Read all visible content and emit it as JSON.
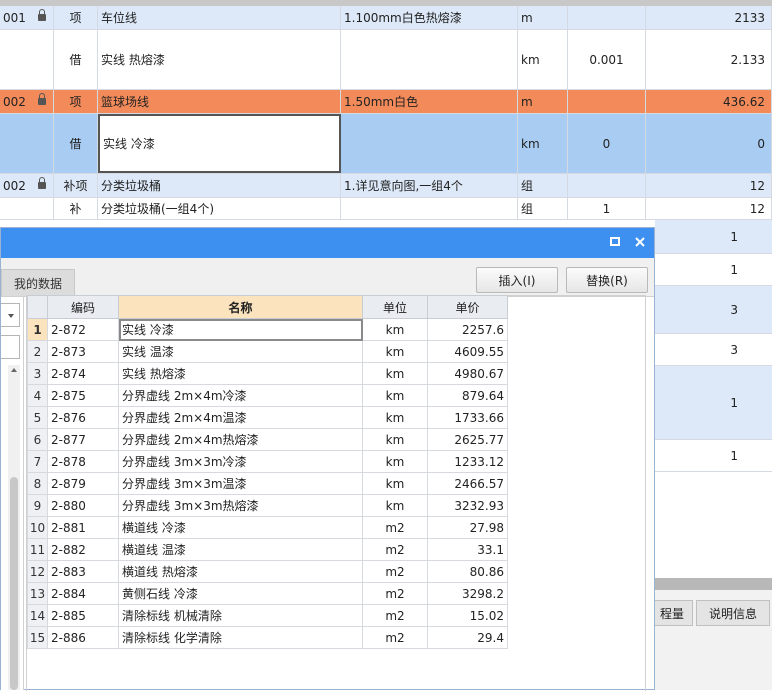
{
  "background_rows": [
    {
      "code": "001",
      "type": "项",
      "name": "车位线",
      "spec": "1.100mm白色热熔漆",
      "unit": "m",
      "qty": "",
      "total": "2133",
      "bg": "#dde9f8",
      "locked": true
    },
    {
      "code": "",
      "type": "借",
      "name": "实线 热熔漆",
      "spec": "",
      "unit": "km",
      "qty": "0.001",
      "total": "2.133",
      "bg": "#ffffff",
      "locked": false
    },
    {
      "code": "002",
      "type": "项",
      "name": "篮球场线",
      "spec": "1.50mm白色",
      "unit": "m",
      "qty": "",
      "total": "436.62",
      "bg": "#f28a5a",
      "locked": true
    },
    {
      "code": "",
      "type": "借",
      "name": "实线 冷漆",
      "spec": "",
      "unit": "km",
      "qty": "0",
      "total": "0",
      "bg": "#a9cdf2",
      "locked": false
    },
    {
      "code": "002",
      "type": "补项",
      "name": "分类垃圾桶",
      "spec": "1.详见意向图,一组4个",
      "unit": "组",
      "qty": "",
      "total": "12",
      "bg": "#dde9f8",
      "locked": true
    },
    {
      "code": "",
      "type": "补",
      "name": "分类垃圾桶(一组4个)",
      "spec": "",
      "unit": "组",
      "qty": "1",
      "total": "12",
      "bg": "#ffffff",
      "locked": false
    }
  ],
  "right_column_values": [
    "1",
    "1",
    "3",
    "3",
    "1",
    "1"
  ],
  "dialog": {
    "tab_label": "我的数据",
    "insert_button": "插入(I)",
    "replace_button": "替换(R)",
    "columns": {
      "code": "编码",
      "name": "名称",
      "unit": "单位",
      "price": "单价"
    },
    "rows": [
      {
        "idx": "1",
        "code": "2-872",
        "name": "实线 冷漆",
        "unit": "km",
        "price": "2257.6"
      },
      {
        "idx": "2",
        "code": "2-873",
        "name": "实线 温漆",
        "unit": "km",
        "price": "4609.55"
      },
      {
        "idx": "3",
        "code": "2-874",
        "name": "实线 热熔漆",
        "unit": "km",
        "price": "4980.67"
      },
      {
        "idx": "4",
        "code": "2-875",
        "name": "分界虚线 2m×4m冷漆",
        "unit": "km",
        "price": "879.64"
      },
      {
        "idx": "5",
        "code": "2-876",
        "name": "分界虚线 2m×4m温漆",
        "unit": "km",
        "price": "1733.66"
      },
      {
        "idx": "6",
        "code": "2-877",
        "name": "分界虚线 2m×4m热熔漆",
        "unit": "km",
        "price": "2625.77"
      },
      {
        "idx": "7",
        "code": "2-878",
        "name": "分界虚线 3m×3m冷漆",
        "unit": "km",
        "price": "1233.12"
      },
      {
        "idx": "8",
        "code": "2-879",
        "name": "分界虚线 3m×3m温漆",
        "unit": "km",
        "price": "2466.57"
      },
      {
        "idx": "9",
        "code": "2-880",
        "name": "分界虚线 3m×3m热熔漆",
        "unit": "km",
        "price": "3232.93"
      },
      {
        "idx": "10",
        "code": "2-881",
        "name": "横道线 冷漆",
        "unit": "m2",
        "price": "27.98"
      },
      {
        "idx": "11",
        "code": "2-882",
        "name": "横道线 温漆",
        "unit": "m2",
        "price": "33.1"
      },
      {
        "idx": "12",
        "code": "2-883",
        "name": "横道线 热熔漆",
        "unit": "m2",
        "price": "80.86"
      },
      {
        "idx": "13",
        "code": "2-884",
        "name": "黄侧石线 冷漆",
        "unit": "m2",
        "price": "3298.2"
      },
      {
        "idx": "14",
        "code": "2-885",
        "name": "清除标线 机械清除",
        "unit": "m2",
        "price": "15.02"
      },
      {
        "idx": "15",
        "code": "2-886",
        "name": "清除标线 化学清除",
        "unit": "m2",
        "price": "29.4"
      }
    ]
  },
  "bottom_tabs": {
    "qty_tab": "程量",
    "desc_tab": "说明信息"
  },
  "icons": {
    "maximize": "maximize-icon",
    "close": "close-icon",
    "lock": "lock-icon",
    "dropdown": "chevron-down-icon",
    "scroll_up": "scroll-up-icon"
  }
}
